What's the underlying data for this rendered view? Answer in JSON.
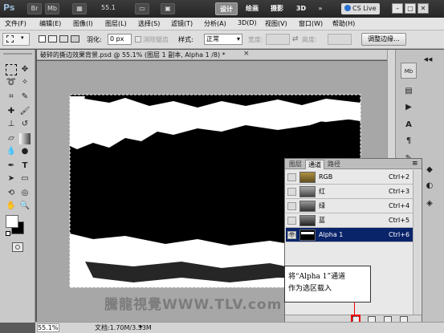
{
  "appbar": {
    "logo": "Ps",
    "zoom": "55.1",
    "workspaces": [
      "设计",
      "绘画",
      "摄影",
      "3D",
      "»"
    ],
    "cslive": "CS Live",
    "window_controls": [
      "–",
      "□",
      "✕"
    ]
  },
  "menubar": {
    "items": [
      "文件(F)",
      "编辑(E)",
      "图像(I)",
      "图层(L)",
      "选择(S)",
      "滤镜(T)",
      "分析(A)",
      "3D(D)",
      "视图(V)",
      "窗口(W)",
      "帮助(H)"
    ]
  },
  "options": {
    "feather_label": "羽化:",
    "feather_value": "0 px",
    "antialias_label": "消除锯齿",
    "style_label": "样式:",
    "style_value": "正常",
    "width_label": "宽度:",
    "height_label": "高度:",
    "refine_button": "调整边缘..."
  },
  "document": {
    "title": "破碎的撕边效果背景.psd @ 55.1% (图层 1 副本, Alpha 1 /8) *",
    "close": "×",
    "zoom_status": "55.1%",
    "doc_size": "文档:1.70M/3.53M"
  },
  "channels": {
    "tabs": [
      "图层",
      "通道",
      "路径"
    ],
    "active_tab": 1,
    "menu_icon": "≡",
    "rows": [
      {
        "name": "RGB",
        "shortcut": "Ctrl+2",
        "visible": false,
        "selected": false
      },
      {
        "name": "红",
        "shortcut": "Ctrl+3",
        "visible": false,
        "selected": false
      },
      {
        "name": "绿",
        "shortcut": "Ctrl+4",
        "visible": false,
        "selected": false
      },
      {
        "name": "蓝",
        "shortcut": "Ctrl+5",
        "visible": false,
        "selected": false
      },
      {
        "name": "Alpha 1",
        "shortcut": "Ctrl+6",
        "visible": true,
        "selected": true
      }
    ],
    "eye_glyph": "👁"
  },
  "callout": {
    "line1": "将“Alpha 1”通道",
    "line2": "作为选区载入"
  },
  "watermark": "騰龍視覺WWW.TLV.com",
  "colors": {
    "highlight": "#e00000",
    "selected_row": "#0a246a"
  },
  "icons": {
    "toolbox": [
      "marquee-icon",
      "move-icon",
      "lasso-icon",
      "magic-wand-icon",
      "crop-icon",
      "eyedropper-icon",
      "brush-icon",
      "healing-icon",
      "stamp-icon",
      "history-brush-icon",
      "eraser-icon",
      "gradient-icon",
      "blur-icon",
      "dodge-icon",
      "pen-icon",
      "type-icon",
      "path-select-icon",
      "shape-icon",
      "3d-rotate-icon",
      "3d-camera-icon",
      "hand-icon",
      "zoom-icon"
    ]
  }
}
